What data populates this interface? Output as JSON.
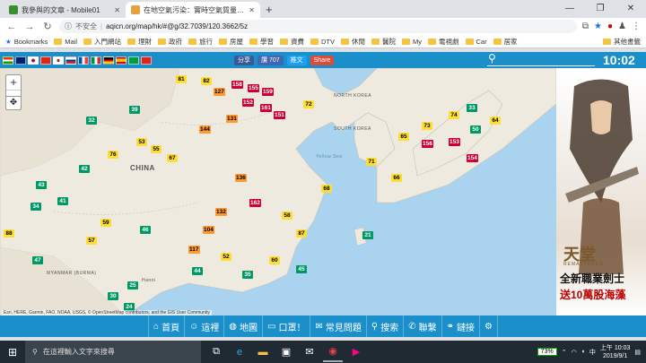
{
  "browser": {
    "tabs": [
      {
        "title": "我參與的文章 - Mobile01",
        "active": false,
        "favicon_color": "#3c8d2f"
      },
      {
        "title": "在地空氣污染：實時空氣質量指數",
        "active": true,
        "favicon_color": "#e6a23c"
      }
    ],
    "new_tab_symbol": "+",
    "window_controls": [
      "—",
      "❐",
      "✕"
    ],
    "security_label": "不安全",
    "url": "aqicn.org/map/hk/#@g/32.7039/120.3662/5z",
    "bookmarks": [
      "Bookmarks",
      "Mail",
      "入門網站",
      "理財",
      "政府",
      "旅行",
      "房屋",
      "學習",
      "資費",
      "DTV",
      "休閒",
      "醫院",
      "My",
      "電視劇",
      "Car",
      "居家",
      "其他書籤"
    ]
  },
  "site_header": {
    "share_fb": "分享",
    "like": "讚 707",
    "tweet": "推文",
    "share_plus": "Share",
    "clock": "10:02"
  },
  "map": {
    "zoom_in": "+",
    "zoom_out": "−",
    "labels": {
      "china": "CHINA",
      "north_korea": "NORTH KOREA",
      "south_korea": "SOUTH KOREA",
      "yellow_sea": "Yellow Sea",
      "myanmar": "MYANMAR (BURMA)",
      "hanoi": "Hanoi"
    },
    "attribution": "Esri, HERE, Garmin, FAO, NOAA, USGS, © OpenStreetMap contributors, and the GIS User Community",
    "markers": [
      {
        "v": "81",
        "c": "y"
      },
      {
        "v": "82",
        "c": "y"
      },
      {
        "v": "158",
        "c": "r"
      },
      {
        "v": "155",
        "c": "r"
      },
      {
        "v": "159",
        "c": "r"
      },
      {
        "v": "127",
        "c": "o"
      },
      {
        "v": "152",
        "c": "r"
      },
      {
        "v": "161",
        "c": "r"
      },
      {
        "v": "151",
        "c": "r"
      },
      {
        "v": "131",
        "c": "o"
      },
      {
        "v": "144",
        "c": "o"
      },
      {
        "v": "72",
        "c": "y"
      },
      {
        "v": "39",
        "c": "g"
      },
      {
        "v": "32",
        "c": "g"
      },
      {
        "v": "53",
        "c": "y"
      },
      {
        "v": "55",
        "c": "y"
      },
      {
        "v": "67",
        "c": "y"
      },
      {
        "v": "76",
        "c": "y"
      },
      {
        "v": "42",
        "c": "g"
      },
      {
        "v": "43",
        "c": "g"
      },
      {
        "v": "41",
        "c": "g"
      },
      {
        "v": "34",
        "c": "g"
      },
      {
        "v": "88",
        "c": "y"
      },
      {
        "v": "59",
        "c": "y"
      },
      {
        "v": "57",
        "c": "y"
      },
      {
        "v": "46",
        "c": "g"
      },
      {
        "v": "47",
        "c": "g"
      },
      {
        "v": "30",
        "c": "g"
      },
      {
        "v": "24",
        "c": "g"
      },
      {
        "v": "25",
        "c": "g"
      },
      {
        "v": "136",
        "c": "o"
      },
      {
        "v": "162",
        "c": "r"
      },
      {
        "v": "132",
        "c": "o"
      },
      {
        "v": "104",
        "c": "o"
      },
      {
        "v": "117",
        "c": "o"
      },
      {
        "v": "65",
        "c": "y"
      },
      {
        "v": "73",
        "c": "y"
      },
      {
        "v": "74",
        "c": "y"
      },
      {
        "v": "33",
        "c": "g"
      },
      {
        "v": "21",
        "c": "g"
      },
      {
        "v": "50",
        "c": "g"
      },
      {
        "v": "64",
        "c": "y"
      },
      {
        "v": "156",
        "c": "r"
      },
      {
        "v": "153",
        "c": "r"
      },
      {
        "v": "154",
        "c": "r"
      },
      {
        "v": "66",
        "c": "y"
      },
      {
        "v": "71",
        "c": "y"
      },
      {
        "v": "87",
        "c": "y"
      },
      {
        "v": "60",
        "c": "y"
      },
      {
        "v": "35",
        "c": "g"
      },
      {
        "v": "44",
        "c": "g"
      },
      {
        "v": "52",
        "c": "y"
      },
      {
        "v": "45",
        "c": "g"
      },
      {
        "v": "58",
        "c": "y"
      },
      {
        "v": "68",
        "c": "y"
      }
    ]
  },
  "ad": {
    "brand": "天堂",
    "brand_sub": "REMASTERED",
    "line1": "全新職業劍士",
    "line2": "送10萬股海藻",
    "close": "ⓘ ✕"
  },
  "bottom_nav": [
    {
      "icon": "home-icon",
      "glyph": "⌂",
      "label": "首頁"
    },
    {
      "icon": "person-icon",
      "glyph": "☺",
      "label": "這裡"
    },
    {
      "icon": "globe-icon",
      "glyph": "◍",
      "label": "地圖"
    },
    {
      "icon": "mask-icon",
      "glyph": "▭",
      "label": "口罩！"
    },
    {
      "icon": "chat-icon",
      "glyph": "✉",
      "label": "常見問題"
    },
    {
      "icon": "search-icon",
      "glyph": "⚲",
      "label": "搜索"
    },
    {
      "icon": "contact-icon",
      "glyph": "✆",
      "label": "聯繫"
    },
    {
      "icon": "link-icon",
      "glyph": "⚭",
      "label": "鏈接"
    },
    {
      "icon": "gear-icon",
      "glyph": "⚙",
      "label": ""
    }
  ],
  "taskbar": {
    "search_placeholder": "在這裡輸入文字來搜尋",
    "battery": "73%",
    "time_period": "上午 10:03",
    "date": "2019/9/1"
  },
  "colors": {
    "site_blue": "#1a8fc9",
    "aqi_good": "#009966",
    "aqi_moderate": "#ffde33",
    "aqi_unhealthy_sensitive": "#ff9933",
    "aqi_unhealthy": "#cc0033"
  }
}
